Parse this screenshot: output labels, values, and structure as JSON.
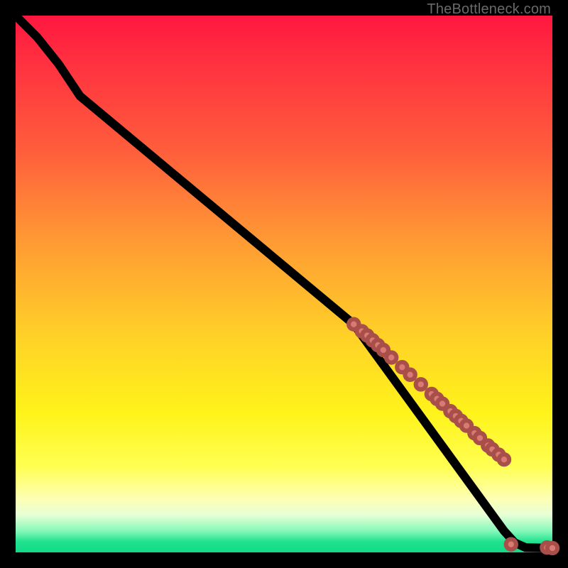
{
  "attribution": "TheBottleneck.com",
  "colors": {
    "dot_fill": "#d97a75",
    "dot_stroke": "#a94f4a",
    "curve": "#000000"
  },
  "chart_data": {
    "type": "line",
    "title": "",
    "xlabel": "",
    "ylabel": "",
    "xlim": [
      0,
      100
    ],
    "ylim": [
      0,
      100
    ],
    "curve": [
      {
        "x": 0,
        "y": 100
      },
      {
        "x": 4,
        "y": 96
      },
      {
        "x": 8,
        "y": 91
      },
      {
        "x": 12,
        "y": 85
      },
      {
        "x": 63,
        "y": 42.5
      },
      {
        "x": 91,
        "y": 4
      },
      {
        "x": 93,
        "y": 1.8
      },
      {
        "x": 95,
        "y": 0.9
      },
      {
        "x": 100,
        "y": 0.8
      }
    ],
    "series": [
      {
        "name": "markers",
        "points": [
          {
            "x": 63.0,
            "y": 42.5
          },
          {
            "x": 64.5,
            "y": 41.2
          },
          {
            "x": 65.5,
            "y": 40.4
          },
          {
            "x": 66.5,
            "y": 39.5
          },
          {
            "x": 67.5,
            "y": 38.6
          },
          {
            "x": 68.5,
            "y": 37.7
          },
          {
            "x": 70.0,
            "y": 36.3
          },
          {
            "x": 72.0,
            "y": 34.5
          },
          {
            "x": 73.5,
            "y": 33.1
          },
          {
            "x": 75.5,
            "y": 31.3
          },
          {
            "x": 77.5,
            "y": 29.5
          },
          {
            "x": 78.5,
            "y": 28.6
          },
          {
            "x": 79.5,
            "y": 27.7
          },
          {
            "x": 81.0,
            "y": 26.3
          },
          {
            "x": 82.0,
            "y": 25.4
          },
          {
            "x": 83.0,
            "y": 24.5
          },
          {
            "x": 84.0,
            "y": 23.6
          },
          {
            "x": 85.5,
            "y": 22.2
          },
          {
            "x": 86.5,
            "y": 21.3
          },
          {
            "x": 88.0,
            "y": 19.9
          },
          {
            "x": 88.8,
            "y": 19.2
          },
          {
            "x": 90.0,
            "y": 18.2
          },
          {
            "x": 91.0,
            "y": 17.3
          },
          {
            "x": 92.3,
            "y": 1.5
          },
          {
            "x": 99.0,
            "y": 0.9
          },
          {
            "x": 100.0,
            "y": 0.8
          }
        ]
      }
    ]
  }
}
